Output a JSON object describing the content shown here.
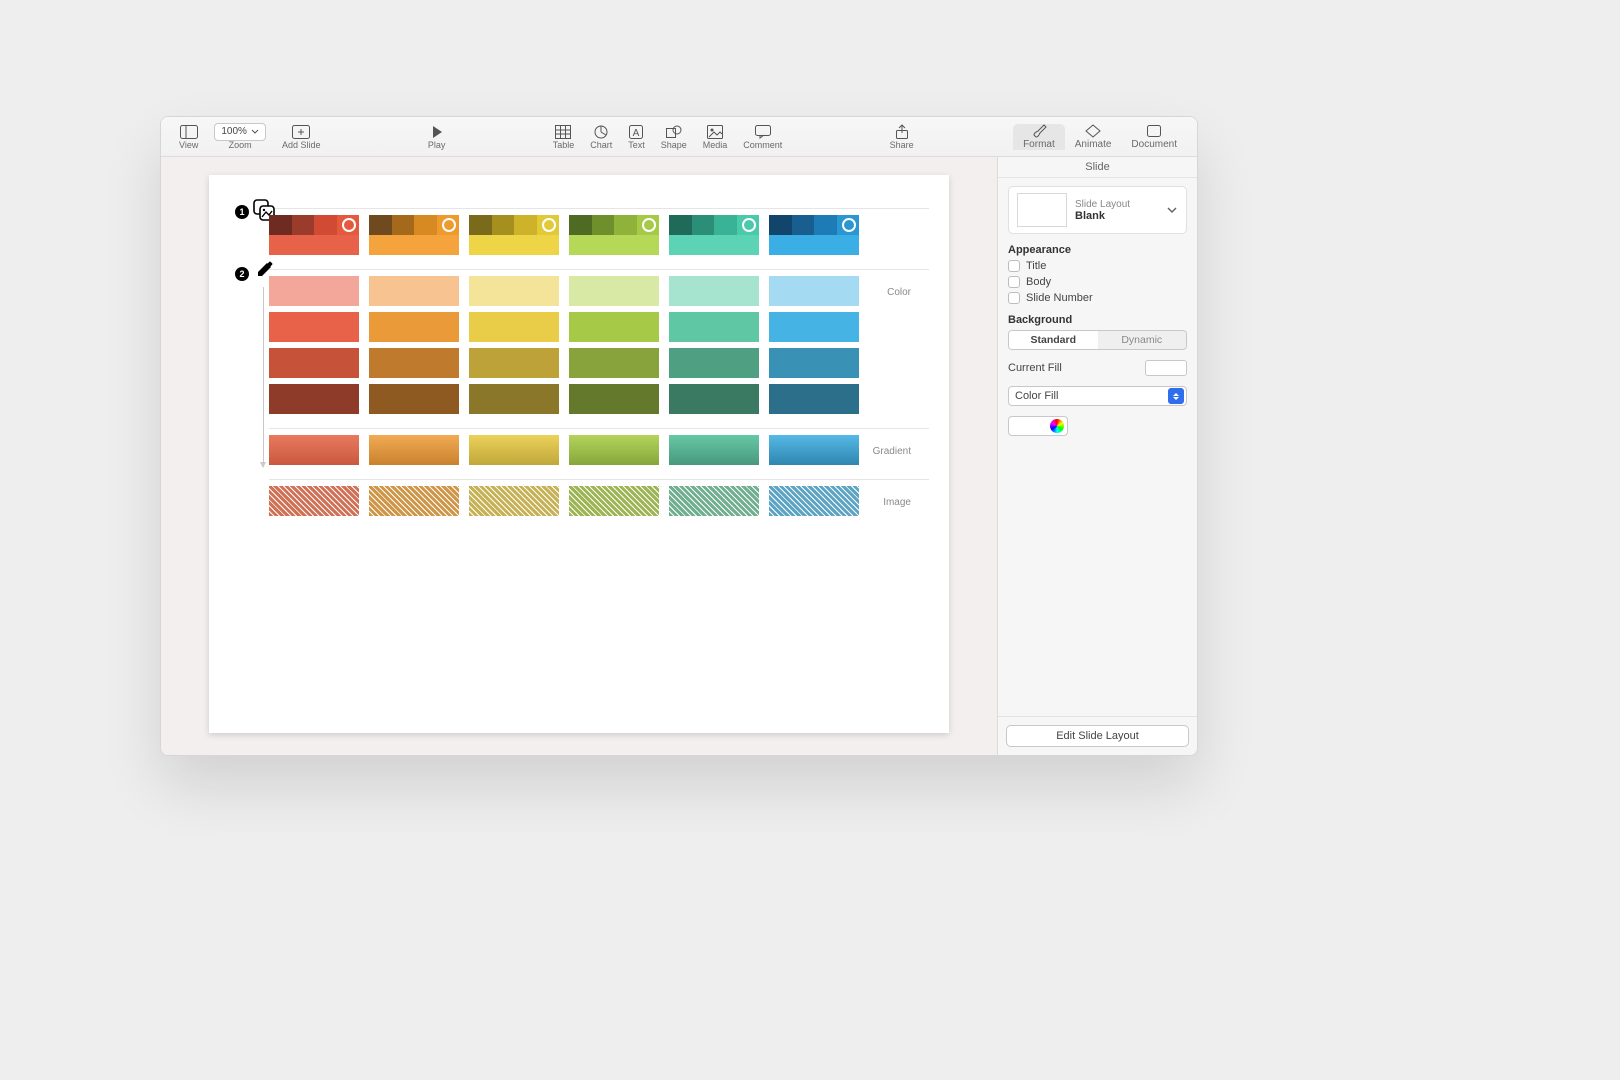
{
  "toolbar": {
    "view": "View",
    "zoom": "Zoom",
    "zoom_value": "100%",
    "add_slide": "Add Slide",
    "play": "Play",
    "table": "Table",
    "chart": "Chart",
    "text": "Text",
    "shape": "Shape",
    "media": "Media",
    "comment": "Comment",
    "share": "Share",
    "format": "Format",
    "animate": "Animate",
    "document": "Document"
  },
  "inspector": {
    "tab_title": "Slide",
    "layout_caption": "Slide Layout",
    "layout_name": "Blank",
    "appearance": "Appearance",
    "chk_title": "Title",
    "chk_body": "Body",
    "chk_slide_number": "Slide Number",
    "background": "Background",
    "seg_standard": "Standard",
    "seg_dynamic": "Dynamic",
    "current_fill": "Current Fill",
    "fill_select": "Color Fill",
    "edit_layout": "Edit Slide Layout"
  },
  "slide": {
    "step1": "1",
    "step2": "2",
    "labels": {
      "color": "Color",
      "gradient": "Gradient",
      "image": "Image"
    },
    "palettes": [
      {
        "shades": [
          "#6f2a22",
          "#9a3b2b",
          "#d14a33",
          "#e55a3f"
        ],
        "base": "#e8624a",
        "ring": true
      },
      {
        "shades": [
          "#6f4a1f",
          "#a5691c",
          "#d78a22",
          "#ef9a2d"
        ],
        "base": "#f5a33c",
        "ring": true
      },
      {
        "shades": [
          "#7a6a1c",
          "#a58f1f",
          "#cdb22a",
          "#e2c938"
        ],
        "base": "#eed447",
        "ring": true
      },
      {
        "shades": [
          "#4f6a22",
          "#6f8f2c",
          "#8fb23a",
          "#a6c948"
        ],
        "base": "#b6d858",
        "ring": true
      },
      {
        "shades": [
          "#1f6a58",
          "#2b8f78",
          "#3ab296",
          "#4bc9ab"
        ],
        "base": "#5dd3b5",
        "ring": true
      },
      {
        "shades": [
          "#12456b",
          "#185f90",
          "#1f7bb6",
          "#2a96d2"
        ],
        "base": "#3aaee5",
        "ring": true
      }
    ],
    "color_rows": [
      [
        "#f3a79a",
        "#f7c491",
        "#f4e49a",
        "#d8e9a6",
        "#a7e4cf",
        "#a4daf2"
      ],
      [
        "#e8624a",
        "#eb9a3a",
        "#e9cd49",
        "#a6c948",
        "#5fc7a3",
        "#45b4e4"
      ],
      [
        "#c55239",
        "#c07a2d",
        "#bda23a",
        "#88a33b",
        "#4f9f83",
        "#3a91b6"
      ],
      [
        "#8e3b29",
        "#8e5a22",
        "#8a772a",
        "#64792b",
        "#3a7a63",
        "#2c6f8a"
      ]
    ],
    "gradient_row": [
      [
        "#e97a5e",
        "#c9583f"
      ],
      [
        "#f2ab53",
        "#c9812f"
      ],
      [
        "#ecd25a",
        "#bfa73a"
      ],
      [
        "#b4d45c",
        "#86a63c"
      ],
      [
        "#67c8a6",
        "#49987d"
      ],
      [
        "#56b9e6",
        "#2f86b0"
      ]
    ],
    "image_row": [
      "#d07055",
      "#cf9647",
      "#c6b154",
      "#9cb452",
      "#6fae8f",
      "#5ca3c4"
    ]
  }
}
